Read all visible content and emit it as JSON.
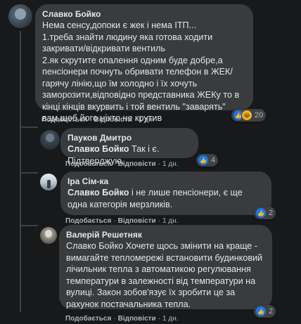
{
  "comments": [
    {
      "author": "Славко Бойко",
      "text": "Нема сенсу,допоки є жек і нема ІТП...\n1.треба знайти людину яка готова ходити закривати/відкривати вентиль\n2.як скрутите опалення одним буде добре,а пенсіонери почнуть обривати телефон в ЖЕК/гарячу лінію,що їм холодно і їх хочуть заморозити,відповідно представника ЖЕКу то в кінці кінців вкурвить і той вентиль \"заварять\" вам,щоб його ніхто не крутив",
      "actions": {
        "like": "Подобається",
        "reply": "Відповісти",
        "time": "1 дн."
      },
      "reactions": {
        "icons": [
          "like-icon",
          "haha-icon"
        ],
        "count": "20"
      }
    },
    {
      "author": "Пауков Дмитро",
      "mention": "Славко Бойко",
      "text": " Так і є. Підтверджую.",
      "actions": {
        "like": "Подобається",
        "reply": "Відповісти",
        "time": "1 дн."
      },
      "reactions": {
        "icons": [
          "like-icon"
        ],
        "count": "4"
      }
    },
    {
      "author": "Іра Сім-ка",
      "mention": "Славко Бойко",
      "text": " і не лише пенсіонери, є ще одна категорія мерзликів.",
      "actions": {
        "like": "Подобається",
        "reply": "Відповісти",
        "time": "1 дн."
      },
      "reactions": {
        "icons": [
          "like-icon"
        ],
        "count": "2"
      }
    },
    {
      "author": "Валерій Решетняк",
      "text": "Славко Бойко Хочете щось змінити на краще - вимагайте тепломережі встановити будинковий лічильник тепла з автоматикою регулювання температури в залежності від температури на вулиці. Закон зобов'язує їх зробити це за рахунок постачальника тепла.",
      "actions": {
        "like": "Подобається",
        "reply": "Відповісти",
        "time": "1 дн."
      },
      "reactions": {
        "icons": [
          "like-icon"
        ],
        "count": "2"
      }
    }
  ],
  "colors": {
    "background": "#18191a",
    "bubble": "#3a3b3c",
    "text": "#e4e6eb",
    "muted": "#b0b3b8",
    "like": "#1877f2"
  }
}
